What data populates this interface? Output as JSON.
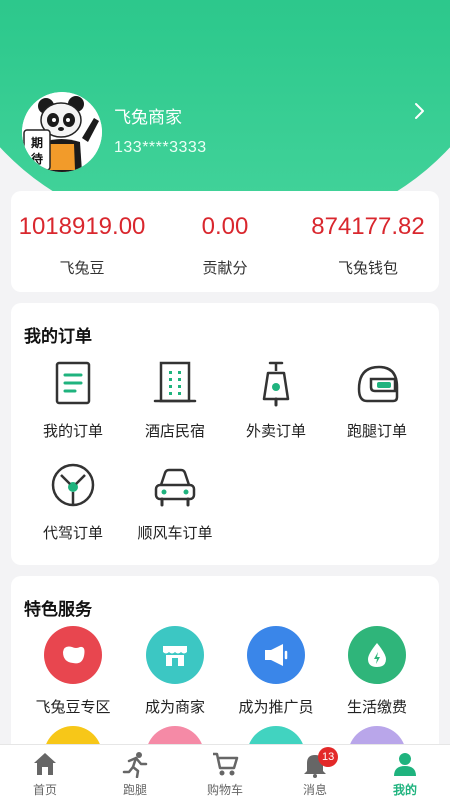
{
  "profile": {
    "name": "飞兔商家",
    "phone": "133****3333",
    "avatar_text": "期待"
  },
  "stats": [
    {
      "value": "1018919.00",
      "label": "飞兔豆"
    },
    {
      "value": "0.00",
      "label": "贡献分"
    },
    {
      "value": "874177.82",
      "label": "飞兔钱包"
    }
  ],
  "orders": {
    "title": "我的订单",
    "items": [
      {
        "label": "我的订单",
        "icon": "order-list-icon"
      },
      {
        "label": "酒店民宿",
        "icon": "hotel-icon"
      },
      {
        "label": "外卖订单",
        "icon": "scooter-icon"
      },
      {
        "label": "跑腿订单",
        "icon": "helmet-icon"
      },
      {
        "label": "代驾订单",
        "icon": "steering-wheel-icon"
      },
      {
        "label": "顺风车订单",
        "icon": "car-icon"
      }
    ]
  },
  "features": {
    "title": "特色服务",
    "items": [
      {
        "label": "飞兔豆专区",
        "icon": "bean-icon",
        "color": "#e8464f"
      },
      {
        "label": "成为商家",
        "icon": "shop-icon",
        "color": "#3cc7c3"
      },
      {
        "label": "成为推广员",
        "icon": "megaphone-icon",
        "color": "#3a86e9"
      },
      {
        "label": "生活缴费",
        "icon": "water-drop-icon",
        "color": "#2fb57a"
      }
    ],
    "peek_colors": [
      "#f7c718",
      "#f58aa6",
      "#41d3c0",
      "#b9a6ea"
    ]
  },
  "tabbar": {
    "tabs": [
      {
        "label": "首页",
        "icon": "home-icon"
      },
      {
        "label": "跑腿",
        "icon": "runner-icon"
      },
      {
        "label": "购物车",
        "icon": "cart-icon"
      },
      {
        "label": "消息",
        "icon": "bell-icon",
        "badge": "13"
      },
      {
        "label": "我的",
        "icon": "user-icon",
        "active": true
      }
    ]
  },
  "colors": {
    "brand_green": "#1fb37e",
    "value_red": "#d9272e"
  }
}
